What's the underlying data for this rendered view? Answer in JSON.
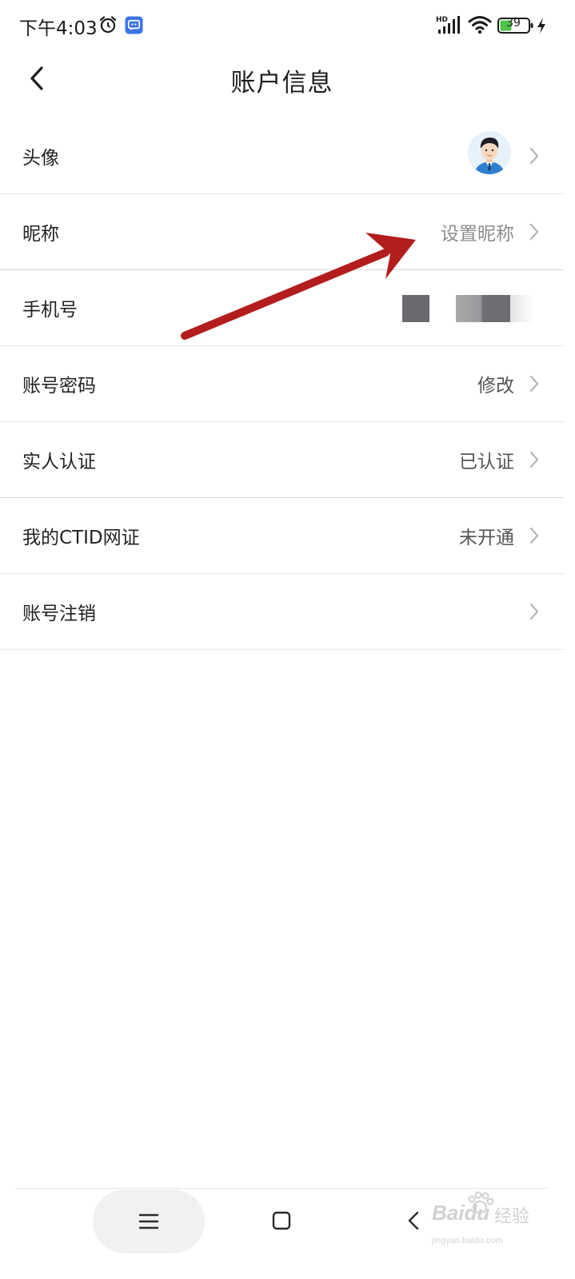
{
  "status_bar": {
    "time": "下午4:03",
    "network_badge": "HD",
    "battery_level": "39",
    "icons": [
      "alarm-icon",
      "message-app-icon",
      "signal-icon",
      "wifi-icon",
      "battery-icon",
      "charging-bolt-icon"
    ]
  },
  "header": {
    "title": "账户信息",
    "back_icon": "chevron-left-icon"
  },
  "rows": [
    {
      "label": "头像",
      "value": "",
      "has_avatar": true,
      "has_chevron": true
    },
    {
      "label": "昵称",
      "value": "设置昵称",
      "has_chevron": true
    },
    {
      "label": "手机号",
      "value": "",
      "value_redacted": true,
      "has_chevron": false
    },
    {
      "label": "账号密码",
      "value": "修改",
      "has_chevron": true
    },
    {
      "label": "实人认证",
      "value": "已认证",
      "has_chevron": true
    },
    {
      "label": "我的CTID网证",
      "value": "未开通",
      "has_chevron": true
    },
    {
      "label": "账号注销",
      "value": "",
      "has_chevron": true
    }
  ],
  "nav_bar": {
    "icons": [
      "menu-icon",
      "home-square-icon",
      "back-triangle-icon"
    ]
  },
  "watermark": {
    "brand": "Baidu",
    "suffix": "经验",
    "url": "jingyan.baidu.com"
  },
  "colors": {
    "background": "#ffffff",
    "text_primary": "#222222",
    "text_secondary": "#555555",
    "text_placeholder": "#8e8e8e",
    "divider": "#e9e9e9",
    "annotation_arrow": "#b31d1d",
    "chevron": "#b5b5b5"
  }
}
